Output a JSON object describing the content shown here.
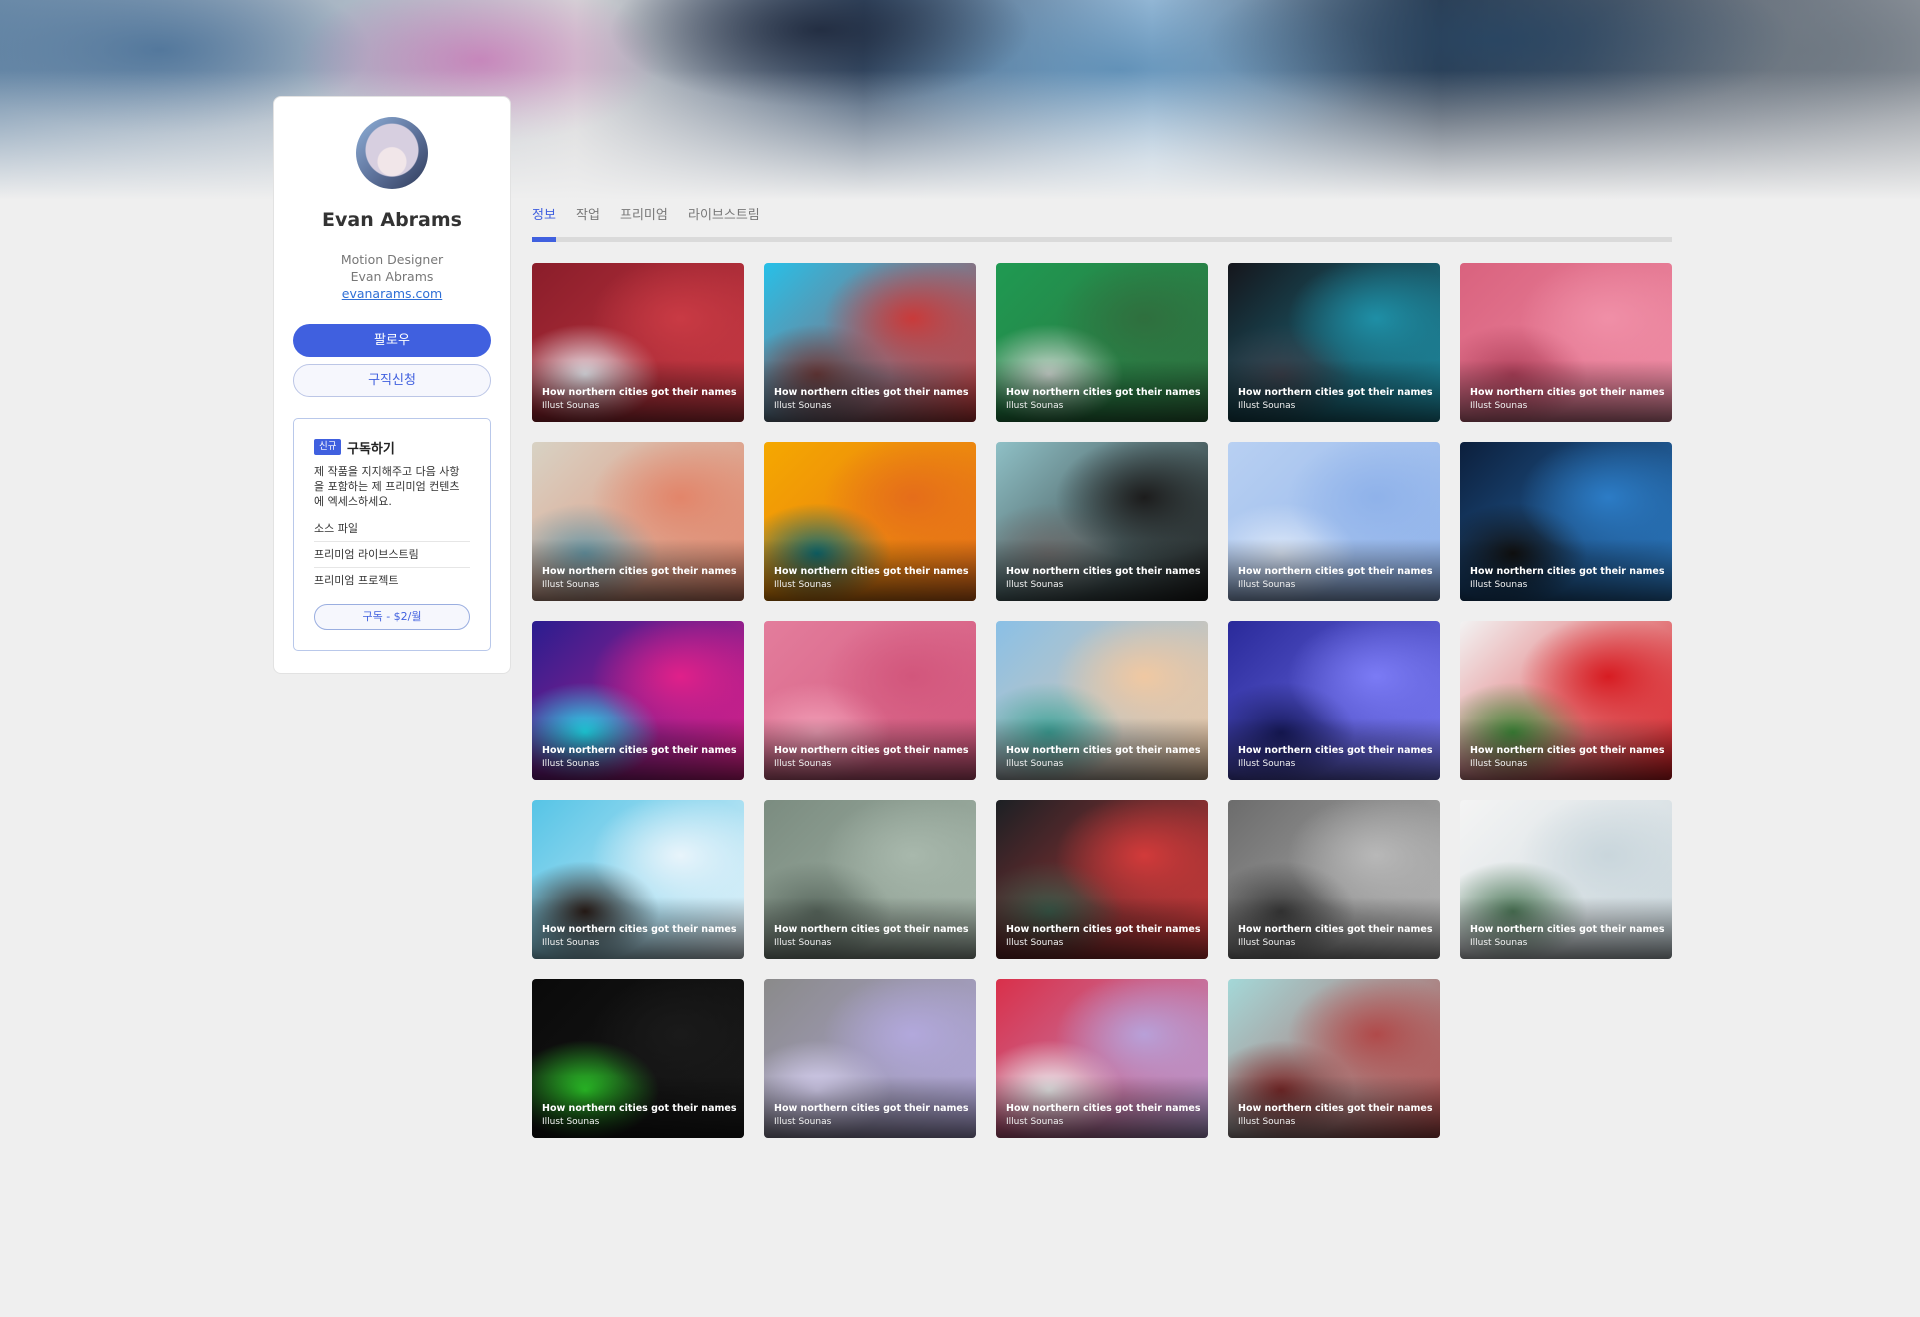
{
  "profile": {
    "name": "Evan Abrams",
    "role": "Motion Designer",
    "realname": "Evan Abrams",
    "website": "evanarams.com",
    "follow_label": "팔로우",
    "hire_label": "구직신청"
  },
  "subscription": {
    "badge": "신규",
    "title": "구독하기",
    "description": "제 작품을 지지해주고 다음 사항을 포함하는 제 프리미엄 컨텐츠에 엑세스하세요.",
    "perks": [
      "소스 파일",
      "프리미엄 라이브스트림",
      "프리미엄 프로젝트"
    ],
    "button_label": "구독 - $2/월"
  },
  "tabs": [
    {
      "label": "정보",
      "active": true
    },
    {
      "label": "작업",
      "active": false
    },
    {
      "label": "프리미엄",
      "active": false
    },
    {
      "label": "라이브스트림",
      "active": false
    }
  ],
  "projects": [
    {
      "title": "How northern cities got their names",
      "author": "Illust Sounas",
      "colors": [
        "#8a1d2a",
        "#c93a44",
        "#e9e9ef"
      ]
    },
    {
      "title": "How northern cities got their names",
      "author": "Illust Sounas",
      "colors": [
        "#27c0e8",
        "#c93a3a",
        "#6a3a3a"
      ]
    },
    {
      "title": "How northern cities got their names",
      "author": "Illust Sounas",
      "colors": [
        "#1f9a52",
        "#2f6f3e",
        "#cfd9d2"
      ]
    },
    {
      "title": "How northern cities got their names",
      "author": "Illust Sounas",
      "colors": [
        "#15161c",
        "#1e8fa6",
        "#3a3f4a"
      ]
    },
    {
      "title": "How northern cities got their names",
      "author": "Illust Sounas",
      "colors": [
        "#d9627e",
        "#f08fa7",
        "#b2425c"
      ]
    },
    {
      "title": "How northern cities got their names",
      "author": "Illust Sounas",
      "colors": [
        "#d8d2c4",
        "#e2856a",
        "#6a9aa8"
      ]
    },
    {
      "title": "How northern cities got their names",
      "author": "Illust Sounas",
      "colors": [
        "#f5a800",
        "#e56d1a",
        "#0f6b70"
      ]
    },
    {
      "title": "How northern cities got their names",
      "author": "Illust Sounas",
      "colors": [
        "#8fc0c6",
        "#1c1c1c",
        "#6d6d6d"
      ]
    },
    {
      "title": "How northern cities got their names",
      "author": "Illust Sounas",
      "colors": [
        "#b8d0f2",
        "#8fb2ea",
        "#dde8f8"
      ]
    },
    {
      "title": "How northern cities got their names",
      "author": "Illust Sounas",
      "colors": [
        "#0c1f3c",
        "#2c7cc6",
        "#111111"
      ]
    },
    {
      "title": "How northern cities got their names",
      "author": "Illust Sounas",
      "colors": [
        "#2a1d8f",
        "#e0208a",
        "#20e0f0"
      ]
    },
    {
      "title": "How northern cities got their names",
      "author": "Illust Sounas",
      "colors": [
        "#e37d9c",
        "#d2567c",
        "#f2a0b8"
      ]
    },
    {
      "title": "How northern cities got their names",
      "author": "Illust Sounas",
      "colors": [
        "#8ac0e6",
        "#f0c8a2",
        "#3fa49a"
      ]
    },
    {
      "title": "How northern cities got their names",
      "author": "Illust Sounas",
      "colors": [
        "#2a2a9a",
        "#7b7bf5",
        "#171a5c"
      ]
    },
    {
      "title": "How northern cities got their names",
      "author": "Illust Sounas",
      "colors": [
        "#f2f2f2",
        "#d71c22",
        "#3f8a3a"
      ]
    },
    {
      "title": "How northern cities got their names",
      "author": "Illust Sounas",
      "colors": [
        "#56c4e6",
        "#e8f4fb",
        "#2a1d18"
      ]
    },
    {
      "title": "How northern cities got their names",
      "author": "Illust Sounas",
      "colors": [
        "#7b8c80",
        "#a8b8ac",
        "#5b6a60"
      ]
    },
    {
      "title": "How northern cities got their names",
      "author": "Illust Sounas",
      "colors": [
        "#1c2024",
        "#d23a3a",
        "#3a5a4a"
      ]
    },
    {
      "title": "How northern cities got their names",
      "author": "Illust Sounas",
      "colors": [
        "#6c6c6c",
        "#b8b8b8",
        "#3a3a3a"
      ]
    },
    {
      "title": "How northern cities got their names",
      "author": "Illust Sounas",
      "colors": [
        "#f4f4f4",
        "#c9d6dc",
        "#4f7a5a"
      ]
    },
    {
      "title": "How northern cities got their names",
      "author": "Illust Sounas",
      "colors": [
        "#0a0a0a",
        "#1a1a1a",
        "#2ed12a"
      ]
    },
    {
      "title": "How northern cities got their names",
      "author": "Illust Sounas",
      "colors": [
        "#8a8a8a",
        "#b2a8dc",
        "#d8d2f2"
      ]
    },
    {
      "title": "How northern cities got their names",
      "author": "Illust Sounas",
      "colors": [
        "#d9304a",
        "#b8a0d8",
        "#f0f0f0"
      ]
    },
    {
      "title": "How northern cities got their names",
      "author": "Illust Sounas",
      "colors": [
        "#a4d8d8",
        "#b04a4a",
        "#7a2a2a"
      ]
    }
  ]
}
